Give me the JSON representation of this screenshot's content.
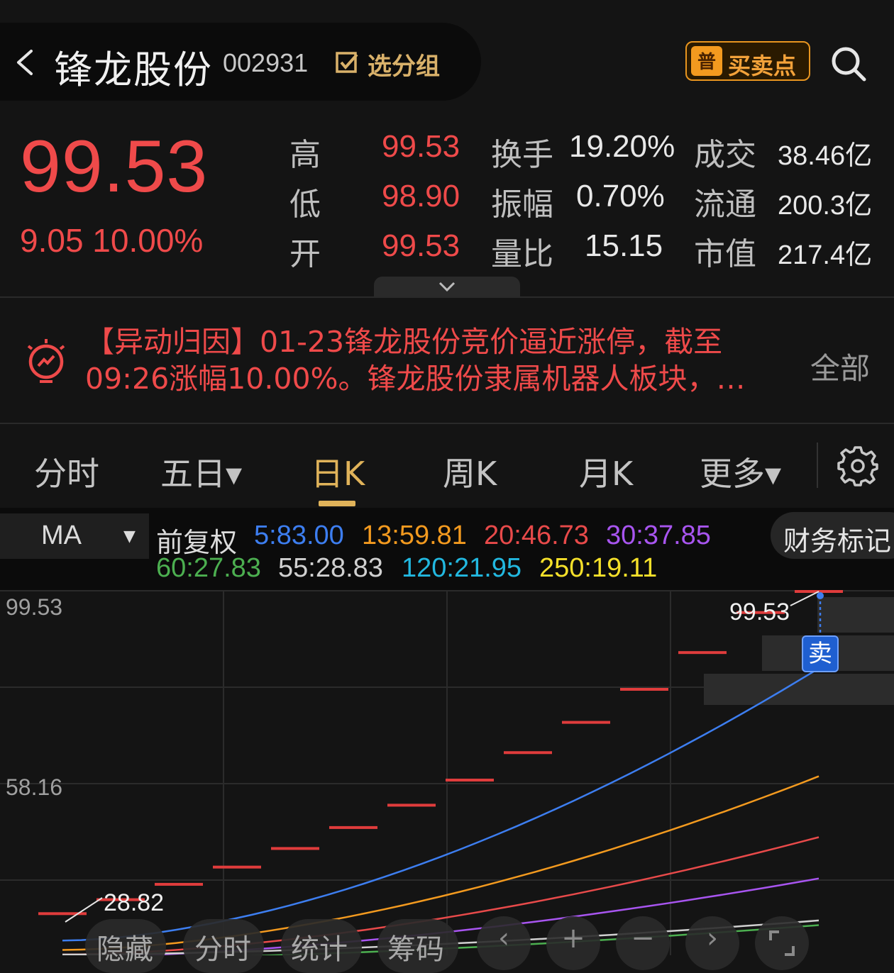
{
  "header": {
    "stock_name": "锋龙股份",
    "stock_code": "002931",
    "group_label": "选分组",
    "trade_icon_text": "普",
    "trade_label": "买卖点"
  },
  "quote": {
    "price": "99.53",
    "change": "9.05 10.00%",
    "high_label": "高",
    "high": "99.53",
    "low_label": "低",
    "low": "98.90",
    "open_label": "开",
    "open": "99.53",
    "turnover_label": "换手",
    "turnover": "19.20%",
    "amplitude_label": "振幅",
    "amplitude": "0.70%",
    "volume_ratio_label": "量比",
    "volume_ratio": "15.15",
    "deal_label": "成交",
    "deal": "38.46亿",
    "float_label": "流通",
    "float": "200.3亿",
    "mktcap_label": "市值",
    "mktcap": "217.4亿"
  },
  "news": {
    "line1": "【异动归因】01-23锋龙股份竞价逼近涨停，截至",
    "line2": "09:26涨幅10.00%。锋龙股份隶属机器人板块，…",
    "all_label": "全部"
  },
  "tabs": [
    {
      "label": "分时",
      "active": false
    },
    {
      "label": "五日▾",
      "active": false
    },
    {
      "label": "日K",
      "active": true
    },
    {
      "label": "周K",
      "active": false
    },
    {
      "label": "月K",
      "active": false
    },
    {
      "label": "更多▾",
      "active": false
    }
  ],
  "ma": {
    "select_label": "MA",
    "caret": "▼",
    "adjust_label": "前复权",
    "items": [
      {
        "text": "5:83.00",
        "color": "#3d7ef0"
      },
      {
        "text": "13:59.81",
        "color": "#f39a1f"
      },
      {
        "text": "20:46.73",
        "color": "#e84a4a"
      },
      {
        "text": "30:37.85",
        "color": "#a855f0"
      },
      {
        "text": "60:27.83",
        "color": "#4caf50"
      },
      {
        "text": "55:28.83",
        "color": "#d0d0d0"
      },
      {
        "text": "120:21.95",
        "color": "#22b8e0"
      },
      {
        "text": "250:19.11",
        "color": "#f5e02a"
      }
    ],
    "finance_label": "财务标记"
  },
  "chart": {
    "y_top": "99.53",
    "y_mid": "58.16",
    "high_marker": "99.53",
    "low_marker": "28.82",
    "sell_label": "卖"
  },
  "chart_data": {
    "type": "line",
    "candles_limit_up": [
      30.3,
      33.3,
      36.6,
      40.3,
      44.3,
      48.8,
      53.6,
      59.0,
      64.9,
      71.4,
      78.5,
      86.4,
      95.0,
      99.53
    ],
    "series": [
      {
        "name": "5",
        "color": "#3d7ef0",
        "last": 83.0
      },
      {
        "name": "13",
        "color": "#f39a1f",
        "last": 59.81
      },
      {
        "name": "20",
        "color": "#e84a4a",
        "last": 46.73
      },
      {
        "name": "30",
        "color": "#a855f0",
        "last": 37.85
      },
      {
        "name": "60",
        "color": "#4caf50",
        "last": 27.83
      },
      {
        "name": "55",
        "color": "#d0d0d0",
        "last": 28.83
      }
    ],
    "ylim": [
      28.82,
      99.53
    ]
  },
  "bottom_bar": {
    "hide_label": "隐藏",
    "intraday_label": "分时",
    "stats_label": "统计",
    "chips_label": "筹码",
    "prev_glyph": "‹",
    "zoom_in_glyph": "+",
    "zoom_out_glyph": "−",
    "next_glyph": "›"
  }
}
